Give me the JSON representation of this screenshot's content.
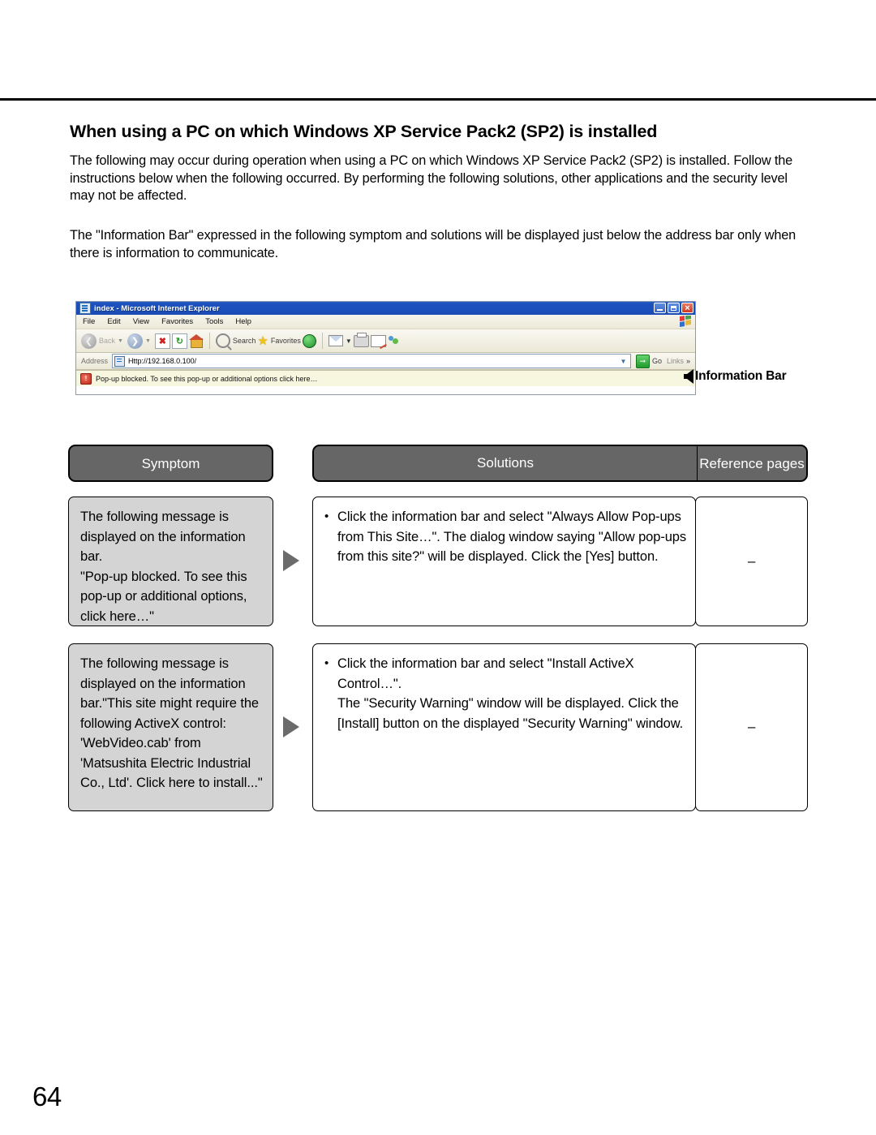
{
  "page": {
    "title": "When using a PC on which Windows XP Service Pack2 (SP2) is installed",
    "paragraph_1": "The following may occur during operation when using a PC on which Windows XP Service Pack2 (SP2) is installed. Follow the instructions below when the following occurred. By performing the following solutions, other applications and the security level may not be affected.",
    "paragraph_2": "The \"Information Bar\" expressed in the following symptom and solutions will be displayed just below the address bar only when there is information to communicate.",
    "page_number": "64"
  },
  "browser": {
    "window_title": "index - Microsoft Internet Explorer",
    "window_buttons": {
      "minimize": "Minimize",
      "maximize": "Maximize",
      "close": "Close"
    },
    "menu": [
      {
        "label": "File",
        "accel": "F",
        "rest": "ile"
      },
      {
        "label": "Edit",
        "accel": "E",
        "rest": "dit"
      },
      {
        "label": "View",
        "accel": "V",
        "rest": "iew"
      },
      {
        "label": "Favorites",
        "accel": "a",
        "pre": "F",
        "rest": "vorites"
      },
      {
        "label": "Tools",
        "accel": "T",
        "rest": "ools"
      },
      {
        "label": "Help",
        "accel": "H",
        "rest": "elp"
      }
    ],
    "toolbar": {
      "back_label": "Back",
      "search_label": "Search",
      "favorites_label": "Favorites"
    },
    "address": {
      "label": "Address",
      "url": "Http://192.168.0.100/",
      "go_label": "Go",
      "links_label": "Links"
    },
    "information_bar": {
      "text": "Pop-up blocked. To see this pop-up or additional options click here…",
      "close": "×"
    },
    "callout_label": "Information Bar"
  },
  "table": {
    "headers": {
      "symptom": "Symptom",
      "solutions": "Solutions",
      "reference_pages": "Reference pages"
    },
    "rows": [
      {
        "symptom": "The following message is displayed on the information bar.\n\"Pop-up blocked. To see this pop-up or additional options, click here…\"",
        "solution_bullet": "Click the information bar and select \"Always Allow Pop-ups from This Site…\". The dialog window saying \"Allow pop-ups from this site?\" will be displayed. Click the [Yes] button.",
        "reference": "–"
      },
      {
        "symptom": "The following message is displayed on the information bar.\"This site might require the following ActiveX control: 'WebVideo.cab' from 'Matsushita Electric Industrial Co., Ltd'. Click here to install...\"",
        "solution_bullet": "Click the information bar and select \"Install ActiveX Control…\".\nThe \"Security Warning\" window will be displayed. Click the [Install] button on the displayed \"Security Warning\" window.",
        "reference": "–"
      }
    ]
  }
}
